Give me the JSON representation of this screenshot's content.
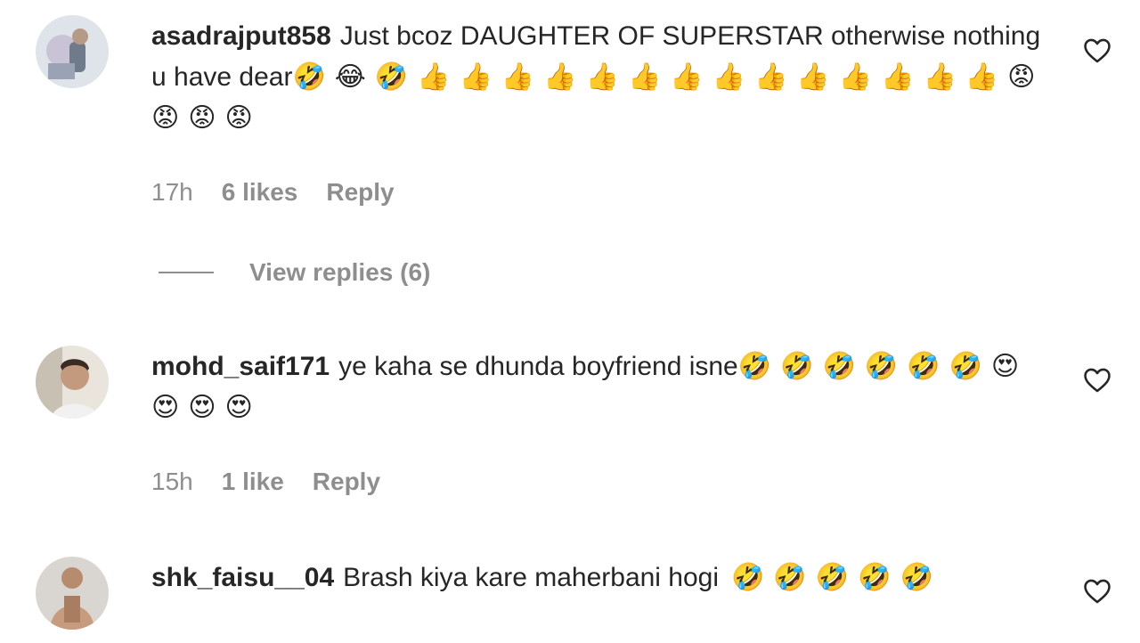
{
  "comments": [
    {
      "username": "asadrajput858",
      "text": "Just bcoz DAUGHTER OF SUPERSTAR otherwise nothing u have dear",
      "emojis": "🤣😂🤣👍👍👍👍👍👍👍👍👍👍👍👍👍👍😡😡😡😡",
      "time": "17h",
      "likes": "6 likes",
      "reply": "Reply",
      "avatar_icon": "user-avatar-photo"
    },
    {
      "username": "mohd_saif171",
      "text": "ye kaha se dhunda boyfriend isne",
      "emojis": "🤣🤣🤣🤣🤣🤣😍😍😍😍",
      "time": "15h",
      "likes": "1 like",
      "reply": "Reply",
      "avatar_icon": "user-avatar-photo"
    },
    {
      "username": "shk_faisu__04",
      "text": "Brash kiya kare maherbani hogi",
      "emojis": "🤣🤣🤣🤣🤣",
      "avatar_icon": "user-avatar-photo"
    }
  ],
  "view_replies": "View replies (6)",
  "colors": {
    "text": "#262626",
    "muted": "#8e8e8e",
    "background": "#ffffff"
  }
}
